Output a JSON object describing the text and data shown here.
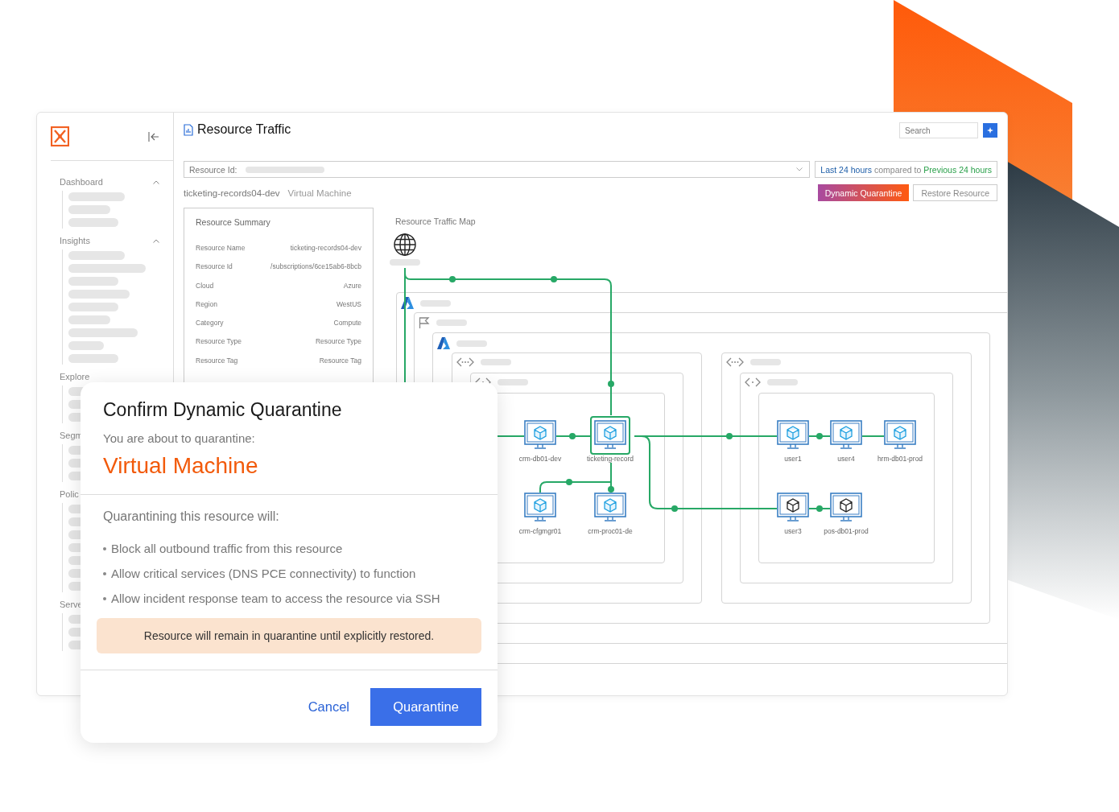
{
  "sidebar": {
    "sections": [
      {
        "label": "Dashboard",
        "expanded": true
      },
      {
        "label": "Insights",
        "expanded": true
      },
      {
        "label": "Explore"
      },
      {
        "label": "Segm"
      },
      {
        "label": "Polic"
      },
      {
        "label": "Serve"
      }
    ]
  },
  "header": {
    "title": "Resource Traffic",
    "search": {
      "placeholder": "Search"
    }
  },
  "resource_id": {
    "label": "Resource Id:"
  },
  "time_range": {
    "current": "Last 24 hours",
    "connector": "compared to",
    "previous": "Previous 24 hours"
  },
  "resource": {
    "name": "ticketing-records04-dev",
    "type": "Virtual Machine"
  },
  "actions": [
    "Dynamic Quarantine",
    "Restore Resource"
  ],
  "summary": {
    "title": "Resource Summary",
    "rows": [
      {
        "label": "Resource Name",
        "value": "ticketing-records04-dev"
      },
      {
        "label": "Resource Id",
        "value": "/subscriptions/6ce15ab6-8bcb"
      },
      {
        "label": "Cloud",
        "value": "Azure"
      },
      {
        "label": "Region",
        "value": "WestUS"
      },
      {
        "label": "Category",
        "value": "Compute"
      },
      {
        "label": "Resource Type",
        "value": "Resource Type"
      },
      {
        "label": "Resource Tag",
        "value": "Resource Tag"
      }
    ]
  },
  "map": {
    "title": "Resource Traffic Map",
    "nodes": [
      {
        "label": "crm-db01-dev",
        "selected": false,
        "active": true
      },
      {
        "label": "ticketing-record",
        "selected": true,
        "active": true
      },
      {
        "label": "user1",
        "selected": false,
        "active": true
      },
      {
        "label": "user4",
        "selected": false,
        "active": true
      },
      {
        "label": "hrm-db01-prod",
        "selected": false,
        "active": true
      },
      {
        "label": "crm-cfgmgr01",
        "selected": false,
        "active": true
      },
      {
        "label": "crm-proc01-de",
        "selected": false,
        "active": true
      },
      {
        "label": "user3",
        "selected": false,
        "active": false
      },
      {
        "label": "pos-db01-prod",
        "selected": false,
        "active": false
      }
    ]
  },
  "dialog": {
    "title": "Confirm Dynamic Quarantine",
    "subtitle": "You are about to quarantine:",
    "target": "Virtual Machine",
    "heading": "Quarantining this resource will:",
    "effects": [
      "Block all outbound traffic from this resource",
      "Allow critical services (DNS PCE connectivity) to function",
      "Allow incident response team to access the resource via SSH"
    ],
    "notice": "Resource will remain in quarantine until explicitly restored.",
    "buttons": [
      {
        "label": "Cancel",
        "kind": "link"
      },
      {
        "label": "Quarantine",
        "kind": "primary"
      }
    ]
  }
}
